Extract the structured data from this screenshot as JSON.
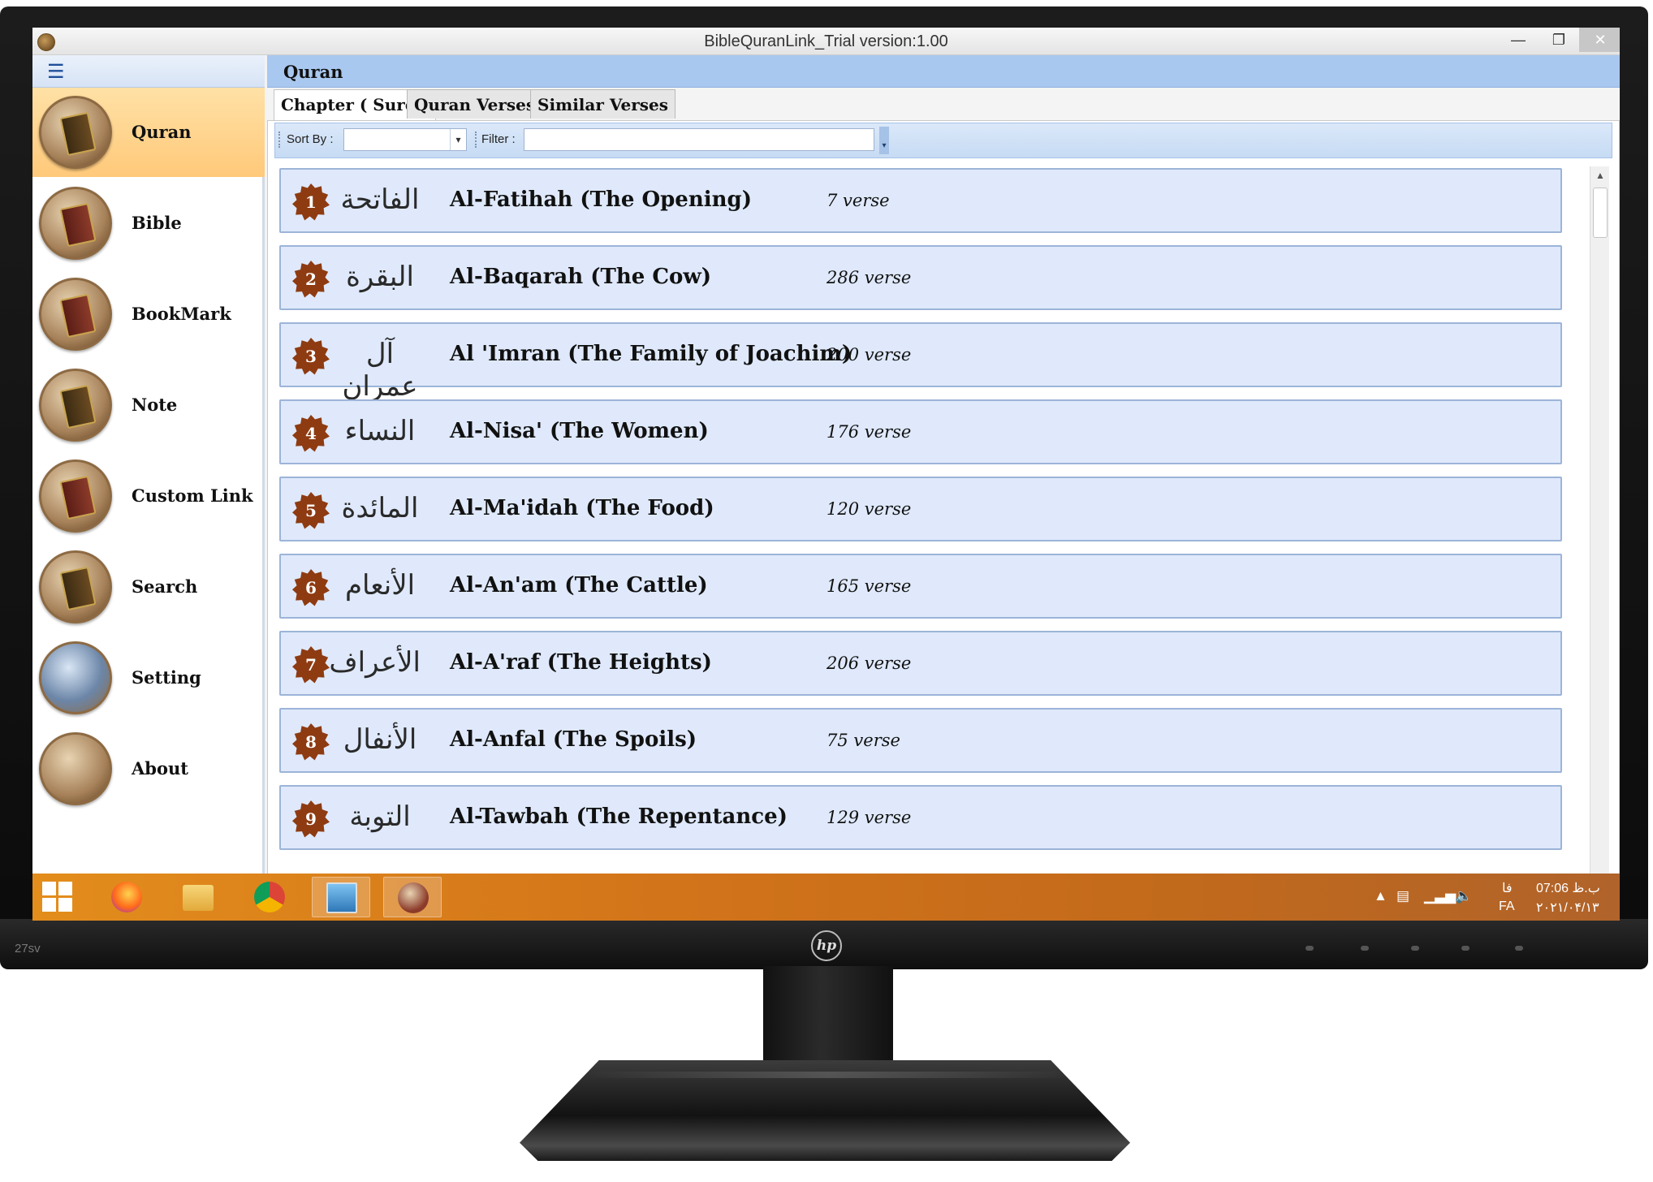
{
  "window": {
    "title": "BibleQuranLink_Trial version:1.00"
  },
  "sidebar": {
    "items": [
      {
        "label": "Quran"
      },
      {
        "label": "Bible"
      },
      {
        "label": "BookMark"
      },
      {
        "label": "Note"
      },
      {
        "label": "Custom Link"
      },
      {
        "label": "Search"
      },
      {
        "label": "Setting"
      },
      {
        "label": "About"
      }
    ],
    "active": "Quran"
  },
  "main": {
    "title": "Quran",
    "tabs": [
      {
        "label": "Chapter ( Sure )"
      },
      {
        "label": "Quran Verses"
      },
      {
        "label": "Similar Verses"
      }
    ],
    "toolbar": {
      "sort_label": "Sort By :",
      "sort_value": "",
      "filter_label": "Filter :",
      "filter_value": ""
    },
    "chapters": [
      {
        "num": "1",
        "arabic": "الفاتحة",
        "name": "Al-Fatihah (The Opening)",
        "verses": "7 verse"
      },
      {
        "num": "2",
        "arabic": "البقرة",
        "name": "Al-Baqarah (The Cow)",
        "verses": "286 verse"
      },
      {
        "num": "3",
        "arabic": "آل عمران",
        "name": "Al 'Imran (The Family of Joachim)",
        "verses": "200 verse"
      },
      {
        "num": "4",
        "arabic": "النساء",
        "name": "Al-Nisa' (The Women)",
        "verses": "176 verse"
      },
      {
        "num": "5",
        "arabic": "المائدة",
        "name": "Al-Ma'idah (The Food)",
        "verses": "120 verse"
      },
      {
        "num": "6",
        "arabic": "الأنعام",
        "name": "Al-An'am (The Cattle)",
        "verses": "165 verse"
      },
      {
        "num": "7",
        "arabic": "الأعراف",
        "name": "Al-A'raf (The Heights)",
        "verses": "206 verse"
      },
      {
        "num": "8",
        "arabic": "الأنفال",
        "name": "Al-Anfal (The Spoils)",
        "verses": "75 verse"
      },
      {
        "num": "9",
        "arabic": "التوبة",
        "name": "Al-Tawbah (The Repentance)",
        "verses": "129 verse"
      }
    ]
  },
  "taskbar": {
    "lang_indicator": "فا",
    "lang_code": "FA",
    "time": "07:06 ب.ظ",
    "date": "۲۰۲۱/۰۴/۱۳"
  },
  "monitor": {
    "model": "27sv",
    "brand": "hp"
  },
  "colors": {
    "accent_header": "#a9c8f0",
    "active_nav": "#ffc97a",
    "card_bg": "#dfe9fb",
    "badge": "#8e3b12",
    "taskbar": "#d2741a"
  },
  "icons": {
    "nav": [
      "quran-book-icon",
      "bible-book-icon",
      "bookmark-icon",
      "note-icon",
      "custom-link-icon",
      "search-icon",
      "setting-icon",
      "about-icon"
    ],
    "taskbar": [
      "windows-start-icon",
      "firefox-icon",
      "file-explorer-icon",
      "chrome-icon",
      "photos-icon",
      "biblequranlink-icon"
    ]
  }
}
